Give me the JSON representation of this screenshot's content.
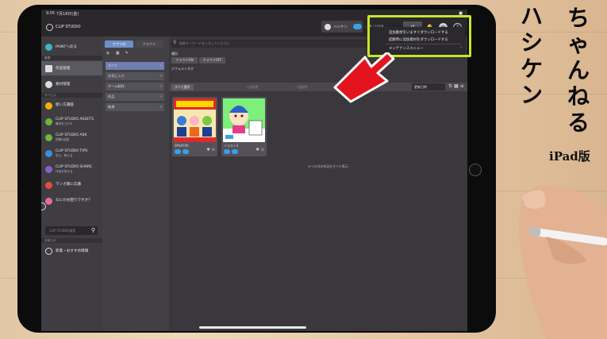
{
  "status_bar": {
    "time": "9:05",
    "date": "7月18日(金)",
    "battery": "■"
  },
  "header": {
    "app_name": "CLIP STUDIO",
    "user_name": "ハシケン",
    "storage": "...GB / 10GB",
    "sync_symbol": "⇄",
    "bell_symbol": "🔔",
    "gear_symbol": "⚙",
    "help_symbol": "?"
  },
  "dropdown": {
    "items": [
      {
        "label": "追加素材をいますぐダウンロードする"
      },
      {
        "label": "起動時に追加素材をダウンロードする"
      },
      {
        "label": "メンテナンスメニュー"
      }
    ]
  },
  "left_nav": {
    "paint_item": "PAINTへ戻る",
    "section_manage": "管理",
    "works": "作品管理",
    "materials": "素材管理",
    "section_service": "サービス",
    "services": [
      {
        "title": "使い方講座",
        "sub": "",
        "color": "#f5b100"
      },
      {
        "title": "CLIP STUDIO ASSETS",
        "sub": "素材をさがす",
        "color": "#69b93c"
      },
      {
        "title": "CLIP STUDIO ASK",
        "sub": "質問&回答",
        "color": "#69b93c"
      },
      {
        "title": "CLIP STUDIO TIPS",
        "sub": "学ぶ、教える",
        "color": "#3a8fe0"
      },
      {
        "title": "CLIP STUDIO SHARE",
        "sub": "作品を見せる",
        "color": "#8860c9"
      },
      {
        "title": "マンガ賞に応募",
        "sub": "",
        "color": "#e0503a"
      },
      {
        "title": "なにかお困りですか？",
        "sub": "",
        "color": "#e86a9a"
      }
    ],
    "search_placeholder": "CLIP STUDIO検索",
    "section_news": "お知らせ",
    "news": "新着・おすすめ情報"
  },
  "mid_col": {
    "tab_app": "アプリ内",
    "tab_cloud": "クラウド",
    "filters": [
      "すべて",
      "お気に入り",
      "チーム制作",
      "作品",
      "新規"
    ]
  },
  "content": {
    "keyword_placeholder": "検索キーワードを入力してください",
    "section_type": "種別",
    "tag_cloud_on": "クラウドON",
    "tag_cloud_off": "クラウドOFF",
    "default_tag": "デフォルトタグ",
    "select_all": "すべて選択",
    "toolbar_dim1": "一括同期",
    "toolbar_dim2": "一括削除",
    "sort": "更新日時",
    "empty_message": "ラベル内の作品をすべて表示",
    "cards": [
      {
        "name": "0PS9700"
      },
      {
        "name": "イラスト2"
      }
    ]
  },
  "overlay": {
    "title_col1": [
      "ハ",
      "シ",
      "ケ",
      "ン"
    ],
    "title_col2": [
      "ち",
      "ゃ",
      "ん",
      "ね",
      "る"
    ],
    "device_label": "iPad版"
  },
  "colors": {
    "highlight": "#c6e62a",
    "arrow": "#e3141e",
    "accent_tab": "#6e90c9"
  }
}
